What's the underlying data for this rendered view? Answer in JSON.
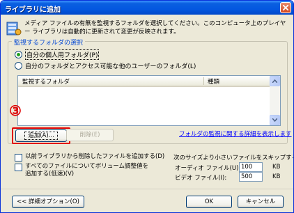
{
  "window": {
    "title": "ライブラリに追加"
  },
  "intro": {
    "text": "メディア ファイルの有無を監視するフォルダを選択してください。このコンピュータ上のプレイヤー ライブラリは自動的に更新されて変更が反映されます。"
  },
  "monitor_group": {
    "legend": "監視するフォルダの選択",
    "options": [
      {
        "label": "自分の個人用フォルダ(P)",
        "checked": true
      },
      {
        "label": "自分のフォルダとアクセス可能な他のユーザーのフォルダ(L)",
        "checked": false
      }
    ],
    "list_columns": [
      "監視するフォルダ",
      "種類"
    ],
    "annotation": "③",
    "add_button": "追加(A)...",
    "remove_button": "削除(E)",
    "help_link": "フォルダの監視に関する詳細を表示します"
  },
  "options": {
    "add_deleted": "以前ライブラリから削除したファイルを追加する(D)",
    "volume_level": "すべてのファイルについてボリューム調整値を追加する(低速)(V)"
  },
  "skip": {
    "heading": "次のサイズより小さいファイルをスキップする:",
    "audio_label": "オーディオ ファイル(U):",
    "audio_value": "100",
    "video_label": "ビデオ ファイル(I):",
    "video_value": "500",
    "unit": "KB"
  },
  "footer": {
    "advanced_button": "<< 詳細オプション(O)",
    "ok_button": "OK",
    "cancel_button": "キャンセル"
  },
  "colors": {
    "title_blue": "#0458e0",
    "accent_red": "#e00000",
    "link_blue": "#0000ff",
    "dialog_bg": "#ece9d8"
  }
}
